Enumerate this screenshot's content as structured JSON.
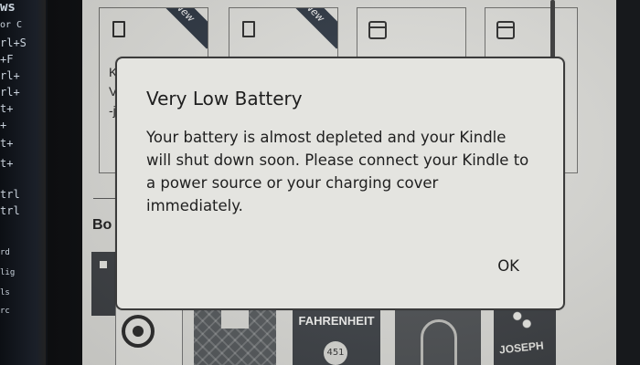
{
  "laptop": {
    "lines": [
      "ws",
      "or C",
      "rl+S",
      "+F",
      "rl+",
      "rl+",
      "t+",
      "+",
      "t+",
      "t+",
      "trl",
      "trl",
      "rd",
      "lig",
      "ls",
      "rc"
    ]
  },
  "library": {
    "new_badge": "New",
    "partial_tile_text": [
      "K",
      "V",
      "-j"
    ],
    "section_title": "Bo"
  },
  "covers": {
    "fahrenheit_title": "FAHRENHEIT",
    "fahrenheit_number": "451",
    "joseph_title": "JOSEPH"
  },
  "dialog": {
    "title": "Very Low Battery",
    "message": "Your battery is almost depleted and your Kindle will shut down soon. Please connect your Kindle to a power source or your charging cover immediately.",
    "ok_label": "OK"
  },
  "colors": {
    "eink_background": "#d9d9d5",
    "dialog_background": "#e4e4e0",
    "ribbon": "#2b3440"
  }
}
